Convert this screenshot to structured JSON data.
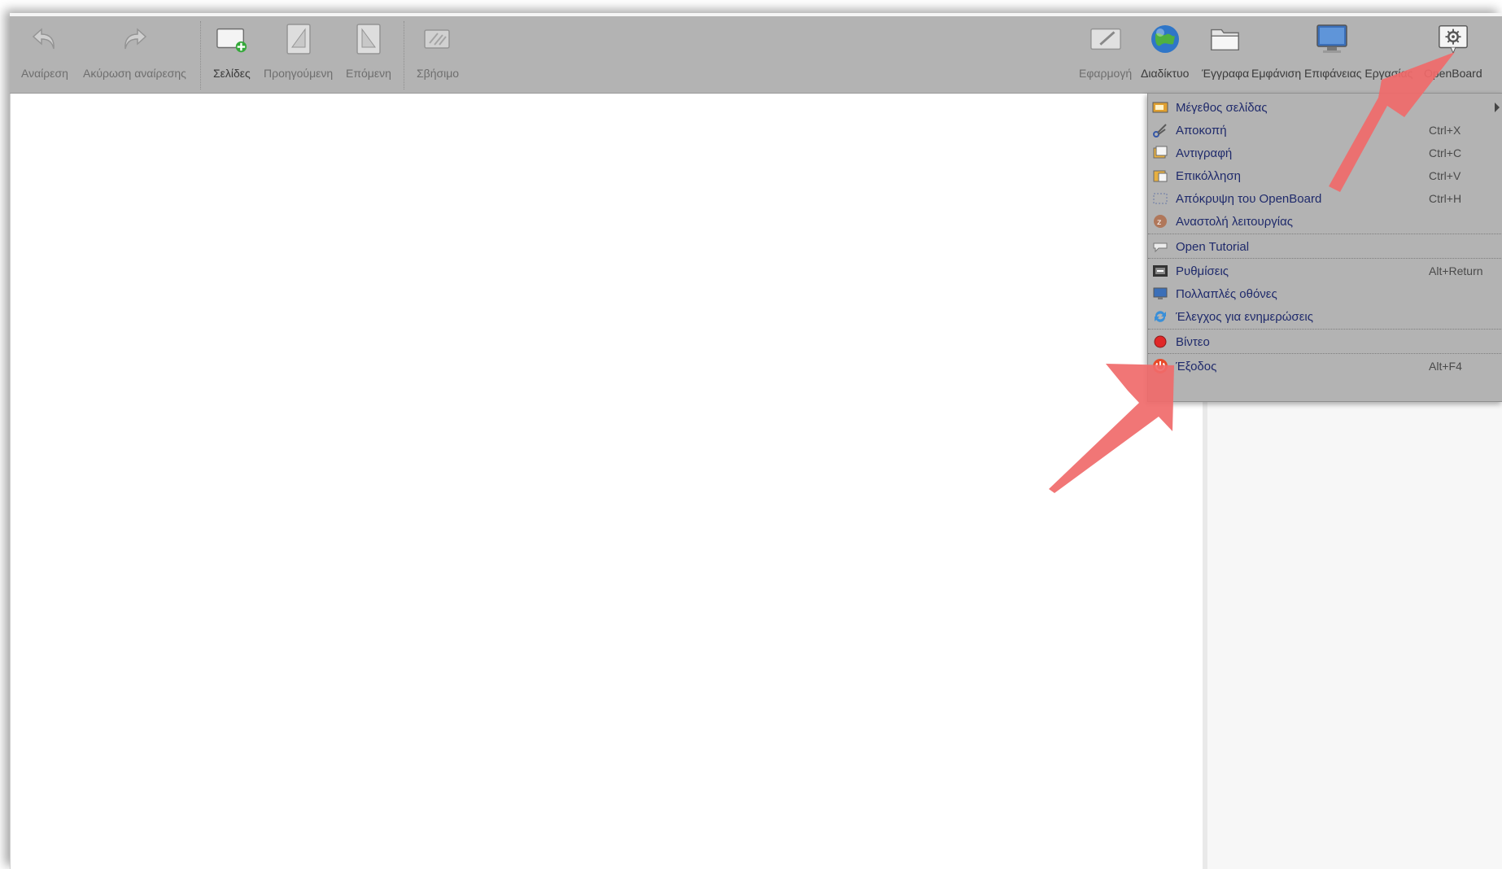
{
  "toolbar": {
    "left": [
      {
        "label": "Αναίρεση",
        "icon": "undo-icon"
      },
      {
        "label": "Ακύρωση αναίρεσης",
        "icon": "redo-icon"
      },
      {
        "label": "Σελίδες",
        "icon": "pages-icon"
      },
      {
        "label": "Προηγούμενη",
        "icon": "previous-page-icon"
      },
      {
        "label": "Επόμενη",
        "icon": "next-page-icon"
      },
      {
        "label": "Σβήσιμο",
        "icon": "erase-icon"
      }
    ],
    "right": [
      {
        "label": "Εφαρμογή",
        "icon": "board-icon"
      },
      {
        "label": "Διαδίκτυο",
        "icon": "globe-icon"
      },
      {
        "label": "Έγγραφα",
        "icon": "folder-icon"
      },
      {
        "label": "Εμφάνιση Επιφάνειας Εργασίας",
        "icon": "desktop-icon"
      },
      {
        "label": "OpenBoard",
        "icon": "settings-gear-icon"
      }
    ]
  },
  "menu": {
    "items": [
      {
        "label": "Μέγεθος σελίδας",
        "shortcut": "",
        "icon": "page-size-icon",
        "submenu": true
      },
      {
        "label": "Αποκοπή",
        "shortcut": "Ctrl+X",
        "icon": "scissors-icon"
      },
      {
        "label": "Αντιγραφή",
        "shortcut": "Ctrl+C",
        "icon": "copy-icon"
      },
      {
        "label": "Επικόλληση",
        "shortcut": "Ctrl+V",
        "icon": "paste-icon"
      },
      {
        "label": "Απόκρυψη του OpenBoard",
        "shortcut": "Ctrl+H",
        "icon": "hide-icon"
      },
      {
        "label": "Αναστολή λειτουργίας",
        "shortcut": "",
        "icon": "sleep-icon"
      },
      {
        "label": "Open Tutorial",
        "shortcut": "",
        "icon": "tutorial-icon"
      },
      {
        "label": "Ρυθμίσεις",
        "shortcut": "Alt+Return",
        "icon": "preferences-icon"
      },
      {
        "label": "Πολλαπλές οθόνες",
        "shortcut": "",
        "icon": "multi-screen-icon"
      },
      {
        "label": "Έλεγχος για ενημερώσεις",
        "shortcut": "",
        "icon": "update-icon"
      },
      {
        "label": "Βίντεο",
        "shortcut": "",
        "icon": "record-icon"
      },
      {
        "label": "Έξοδος",
        "shortcut": "Alt+F4",
        "icon": "power-icon"
      }
    ]
  },
  "colors": {
    "toolbar_bg": "#b3b3b3",
    "menu_text": "#1f2a6b",
    "annotation_arrow": "#f06a6a"
  }
}
